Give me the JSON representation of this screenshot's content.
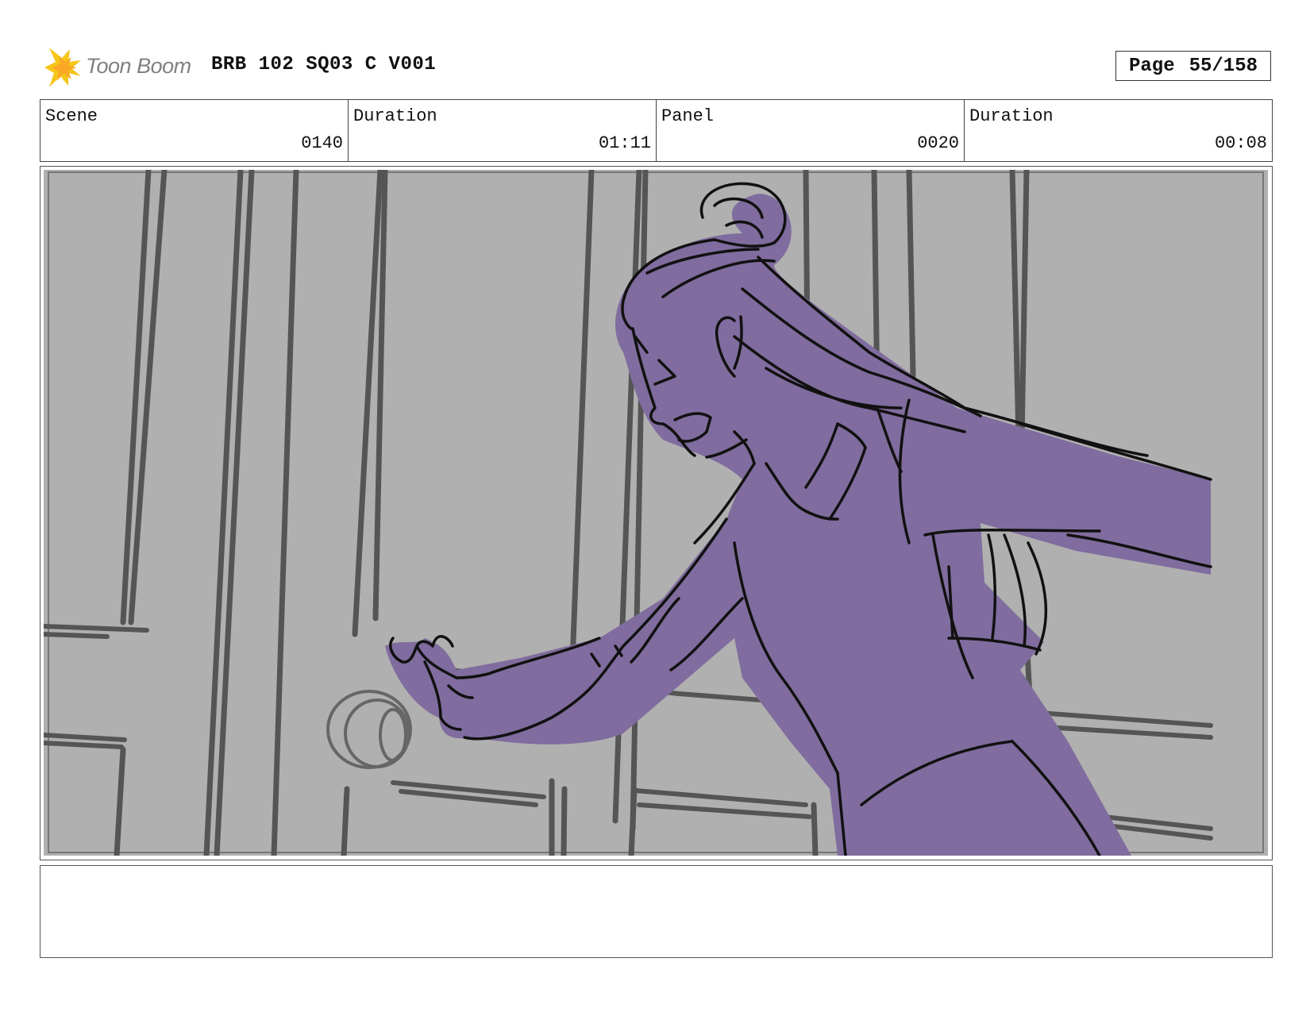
{
  "header": {
    "logo_text": "Toon Boom",
    "logo_icon": "toon-boom-star-icon",
    "title": "BRB 102 SQ03 C V001",
    "page_label": "Page",
    "page_value": "55/158"
  },
  "info": {
    "scene_label": "Scene",
    "scene_value": "0140",
    "scene_duration_label": "Duration",
    "scene_duration_value": "01:11",
    "panel_label": "Panel",
    "panel_value": "0020",
    "panel_duration_label": "Duration",
    "panel_duration_value": "00:08"
  },
  "panel": {
    "background_color": "#b0b0b0",
    "character_fill_color": "#806c9e",
    "line_color": "#111111",
    "background_line_color": "#555555"
  },
  "notes": {
    "text": ""
  }
}
